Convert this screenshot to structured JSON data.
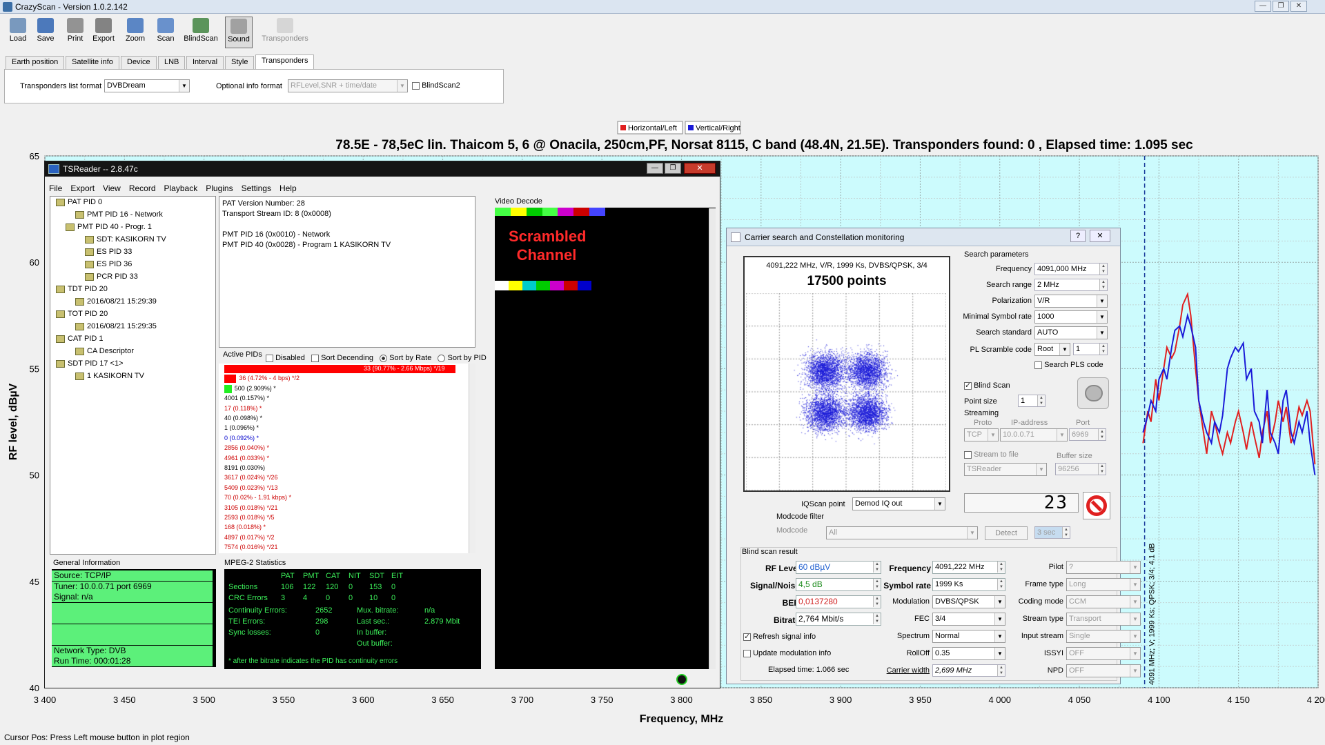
{
  "app": {
    "title": "CrazyScan - Version 1.0.2.142",
    "window_buttons": [
      "—",
      "❐",
      "✕"
    ]
  },
  "toolbar": [
    {
      "label": "Load",
      "icon": "load-icon"
    },
    {
      "label": "Save",
      "icon": "save-icon"
    },
    {
      "label": "Print",
      "icon": "print-icon"
    },
    {
      "label": "Export",
      "icon": "export-icon"
    },
    {
      "label": "Zoom",
      "icon": "zoom-icon"
    },
    {
      "label": "Scan",
      "icon": "scan-icon"
    },
    {
      "label": "BlindScan",
      "icon": "blindscan-icon"
    },
    {
      "label": "Sound",
      "icon": "sound-icon",
      "pressed": true
    },
    {
      "label": "Transponders",
      "icon": "transponders-icon",
      "disabled": true
    }
  ],
  "tabs": [
    "Earth position",
    "Satellite info",
    "Device",
    "LNB",
    "Interval",
    "Style",
    "Transponders"
  ],
  "active_tab": "Transponders",
  "transponders_panel": {
    "list_format_label": "Transponders list format",
    "list_format_value": "DVBDream",
    "optional_label": "Optional info format",
    "optional_value": "RFLevel,SNR + time/date",
    "blindscan2_label": "BlindScan2"
  },
  "chart_data": {
    "type": "line",
    "title": "78.5E - 78,5eC lin. Thaicom 5, 6 @ Onacila, 250cm,PF, Norsat 8115, C band (48.4N, 21.5E). Transponders found: 0 , Elapsed time: 1.095 sec",
    "xlabel": "Frequency, MHz",
    "ylabel": "RF level, dBµV",
    "xlim": [
      3400,
      4200
    ],
    "ylim": [
      40,
      65
    ],
    "x_ticks": [
      "3 400",
      "3 450",
      "3 500",
      "3 550",
      "3 600",
      "3 650",
      "3 700",
      "3 750",
      "3 800",
      "3 850",
      "3 900",
      "3 950",
      "4 000",
      "4 050",
      "4 100",
      "4 150",
      "4 200"
    ],
    "y_ticks": [
      "40",
      "45",
      "50",
      "55",
      "60",
      "65"
    ],
    "legend": {
      "position": "top-center",
      "entries": [
        {
          "name": "Horizontal/Left",
          "color": "#e02020"
        },
        {
          "name": "Vertical/Right",
          "color": "#1a1ad8"
        }
      ]
    },
    "background": "#ccfbfd",
    "marker": {
      "x": 4091,
      "label": "4091 MHz; V; 1999 Ks; QPSK; 3/4; 4.1 dB"
    },
    "series": [
      {
        "name": "Horizontal/Left",
        "color": "#e02020",
        "x": [
          4090,
          4093,
          4095,
          4098,
          4100,
          4103,
          4105,
          4108,
          4110,
          4113,
          4115,
          4118,
          4120,
          4123,
          4125,
          4128,
          4130,
          4133,
          4135,
          4138,
          4140,
          4143,
          4145,
          4148,
          4150,
          4153,
          4155,
          4158,
          4160,
          4163,
          4165,
          4168,
          4170,
          4173,
          4175,
          4178,
          4180,
          4183,
          4185,
          4188,
          4190,
          4193,
          4195,
          4198
        ],
        "values": [
          51.5,
          53.0,
          52.5,
          54.5,
          53.5,
          55.0,
          56.0,
          55.5,
          55.8,
          57.0,
          58.0,
          58.5,
          57.5,
          55.0,
          53.5,
          52.0,
          51.0,
          53.0,
          52.5,
          51.5,
          51.0,
          52.0,
          51.5,
          52.5,
          53.0,
          52.0,
          51.2,
          52.5,
          51.8,
          50.8,
          52.0,
          53.0,
          51.5,
          52.5,
          53.5,
          52.5,
          53.2,
          51.5,
          52.0,
          53.2,
          52.8,
          53.5,
          53.0,
          50.5
        ]
      },
      {
        "name": "Vertical/Right",
        "color": "#1a1ad8",
        "x": [
          4090,
          4093,
          4095,
          4098,
          4100,
          4103,
          4105,
          4108,
          4110,
          4113,
          4115,
          4118,
          4120,
          4123,
          4125,
          4128,
          4130,
          4133,
          4135,
          4138,
          4140,
          4143,
          4145,
          4148,
          4150,
          4153,
          4155,
          4158,
          4160,
          4163,
          4165,
          4168,
          4170,
          4173,
          4175,
          4178,
          4180,
          4183,
          4185,
          4188,
          4190,
          4193,
          4195,
          4198
        ],
        "values": [
          52.0,
          52.8,
          53.5,
          53.0,
          54.5,
          55.0,
          54.5,
          56.0,
          56.8,
          57.0,
          56.5,
          57.5,
          57.0,
          56.0,
          53.5,
          52.5,
          52.0,
          51.5,
          52.5,
          52.0,
          52.8,
          55.0,
          55.5,
          56.0,
          55.8,
          56.2,
          54.5,
          55.0,
          53.0,
          52.5,
          51.5,
          54.0,
          52.0,
          51.5,
          51.0,
          53.5,
          54.0,
          52.0,
          51.5,
          52.5,
          52.0,
          53.0,
          51.5,
          50.0
        ]
      }
    ]
  },
  "tsreader": {
    "title": "TSReader -- 2.8.47c",
    "menu": [
      "File",
      "Export",
      "View",
      "Record",
      "Playback",
      "Plugins",
      "Settings",
      "Help"
    ],
    "tree": [
      {
        "label": "PAT PID 0",
        "indent": 0
      },
      {
        "label": "PMT PID 16 - Network",
        "indent": 2
      },
      {
        "label": "PMT PID 40 - Progr. 1",
        "indent": 1
      },
      {
        "label": "SDT: KASIKORN TV",
        "indent": 3
      },
      {
        "label": "ES PID 33",
        "indent": 3
      },
      {
        "label": "ES PID 36",
        "indent": 3
      },
      {
        "label": "PCR PID 33",
        "indent": 3
      },
      {
        "label": "TDT PID 20",
        "indent": 0
      },
      {
        "label": "2016/08/21 15:29:39",
        "indent": 2
      },
      {
        "label": "TOT PID 20",
        "indent": 0
      },
      {
        "label": "2016/08/21 15:29:35",
        "indent": 2
      },
      {
        "label": "CAT PID 1",
        "indent": 0
      },
      {
        "label": "CA Descriptor",
        "indent": 2
      },
      {
        "label": "SDT PID 17 <1>",
        "indent": 0
      },
      {
        "label": "1 KASIKORN TV",
        "indent": 2
      }
    ],
    "info_text": [
      "PAT Version Number: 28",
      "Transport Stream ID: 8 (0x0008)",
      "",
      "PMT PID 16 (0x0010) - Network",
      "PMT PID 40 (0x0028) - Program 1 KASIKORN TV"
    ],
    "video_decode_label": "Video Decode",
    "scrambled": "Scrambled Channel",
    "active_pids_label": "Active PIDs",
    "pid_options": [
      "Disabled",
      "Sort Decending",
      "Sort by Rate",
      "Sort by PID"
    ],
    "pid_rows": [
      {
        "text": "33 (90.77% - 2.66 Mbps) */19",
        "color": "#ffffff",
        "bar": 1.0,
        "bar_color": "#ff0000"
      },
      {
        "text": "36 (4.72% - 4 bps) */2",
        "color": "#cc0000",
        "bar": 0.052,
        "bar_color": "#ff0000"
      },
      {
        "text": "500 (2.909%) *",
        "color": "#000000",
        "bar": 0.032,
        "bar_color": "#22ee22"
      },
      {
        "text": "4001 (0.157%) *",
        "color": "#000000",
        "bar": 0,
        "bar_color": "#ff0000"
      },
      {
        "text": "17 (0.118%) *",
        "color": "#cc0000",
        "bar": 0,
        "bar_color": "#ff0000"
      },
      {
        "text": "40 (0.098%) *",
        "color": "#000000",
        "bar": 0,
        "bar_color": "#ff0000"
      },
      {
        "text": "1 (0.096%) *",
        "color": "#000000",
        "bar": 0,
        "bar_color": "#ff0000"
      },
      {
        "text": "0 (0.092%) *",
        "color": "#0000cc",
        "bar": 0,
        "bar_color": "#ff0000"
      },
      {
        "text": "2856 (0.040%) *",
        "color": "#cc0000",
        "bar": 0,
        "bar_color": "#ff0000"
      },
      {
        "text": "4961 (0.033%) *",
        "color": "#cc0000",
        "bar": 0,
        "bar_color": "#ff0000"
      },
      {
        "text": "8191 (0.030%)",
        "color": "#000000",
        "bar": 0,
        "bar_color": "#ff0000"
      },
      {
        "text": "3617 (0.024%) */26",
        "color": "#cc0000",
        "bar": 0,
        "bar_color": "#ff0000"
      },
      {
        "text": "5409 (0.023%) */13",
        "color": "#cc0000",
        "bar": 0,
        "bar_color": "#ff0000"
      },
      {
        "text": "70 (0.02% - 1.91 kbps) *",
        "color": "#cc0000",
        "bar": 0,
        "bar_color": "#ff0000"
      },
      {
        "text": "3105 (0.018%) */21",
        "color": "#cc0000",
        "bar": 0,
        "bar_color": "#ff0000"
      },
      {
        "text": "2593 (0.018%) */5",
        "color": "#cc0000",
        "bar": 0,
        "bar_color": "#ff0000"
      },
      {
        "text": "168 (0.018%) *",
        "color": "#cc0000",
        "bar": 0,
        "bar_color": "#ff0000"
      },
      {
        "text": "4897 (0.017%) */2",
        "color": "#cc0000",
        "bar": 0,
        "bar_color": "#ff0000"
      },
      {
        "text": "7574 (0.016%) */21",
        "color": "#cc0000",
        "bar": 0,
        "bar_color": "#ff0000"
      }
    ],
    "general_info_label": "General Information",
    "general_info": [
      "Source: TCP/IP",
      "Tuner: 10.0.0.71 port 6969",
      "Signal: n/a",
      "",
      "",
      "",
      "",
      "Network Type: DVB",
      "Run Time: 000:01:28"
    ],
    "mpeg_label": "MPEG-2 Statistics",
    "mpeg_headers": [
      "PAT",
      "PMT",
      "CAT",
      "NIT",
      "SDT",
      "EIT"
    ],
    "mpeg_rows": [
      {
        "label": "Sections",
        "values": [
          "106",
          "122",
          "120",
          "0",
          "153",
          "0"
        ]
      },
      {
        "label": "CRC Errors",
        "values": [
          "3",
          "4",
          "0",
          "0",
          "10",
          "0"
        ]
      }
    ],
    "mpeg_extra": [
      {
        "label": "Continuity Errors:",
        "value": "2652",
        "label2": "Mux. bitrate:",
        "value2": "n/a"
      },
      {
        "label": "TEI Errors:",
        "value": "298",
        "label2": "Last sec.:",
        "value2": "2.879 Mbit"
      },
      {
        "label": "Sync losses:",
        "value": "0",
        "label2": "In buffer:",
        "value2": ""
      },
      {
        "label": "",
        "value": "",
        "label2": "Out buffer:",
        "value2": ""
      }
    ],
    "mpeg_note": "* after the bitrate indicates the PID has continuity errors"
  },
  "carrier": {
    "title": "Carrier search and Constellation monitoring",
    "title_buttons": [
      "?",
      "✕"
    ],
    "plot_caption": "4091,222 MHz, V/R, 1999 Ks, DVBS/QPSK, 3/4",
    "points_label": "17500 points",
    "search_params_label": "Search parameters",
    "params": [
      {
        "label": "Frequency",
        "value": "4091,000 MHz",
        "kind": "spin"
      },
      {
        "label": "Search range",
        "value": "2 MHz",
        "kind": "spin"
      },
      {
        "label": "Polarization",
        "value": "V/R",
        "kind": "combo"
      },
      {
        "label": "Minimal Symbol rate",
        "value": "1000",
        "kind": "combo"
      },
      {
        "label": "Search standard",
        "value": "AUTO",
        "kind": "combo"
      }
    ],
    "pl_scramble_label": "PL Scramble code",
    "pl_scramble_value": "Root",
    "pl_scramble_num": "1",
    "search_pls_label": "Search PLS code",
    "blind_scan_label": "Blind Scan",
    "point_size_label": "Point size",
    "point_size_value": "1",
    "streaming_label": "Streaming",
    "proto_label": "Proto",
    "proto_value": "TCP",
    "ip_label": "IP-address",
    "ip_value": "10.0.0.71",
    "port_label": "Port",
    "port_value": "6969",
    "stream_file_label": "Stream to file",
    "buffer_label": "Buffer size",
    "buffer_value": "96256",
    "stream_target": "TSReader",
    "iq_label": "IQScan point",
    "iq_value": "Demod IQ out",
    "counter": "23",
    "modcode_filter_label": "Modcode filter",
    "modcode_label": "Modcode",
    "modcode_value": "All",
    "detect_label": "Detect",
    "detect_time": "3 sec",
    "blind_result_label": "Blind scan result",
    "rf_level_label": "RF Level",
    "rf_level_value": "60 dBµV",
    "snr_label": "Signal/Noise",
    "snr_value": "4,5 dB",
    "ber_label": "BER",
    "ber_value": "0,0137280",
    "bitrate_label": "Bitrate",
    "bitrate_value": "2,764 Mbit/s",
    "freq_label": "Frequency",
    "freq_value": "4091,222 MHz",
    "symrate_label": "Symbol rate",
    "symrate_value": "1999 Ks",
    "modulation_label": "Modulation",
    "modulation_value": "DVBS/QPSK",
    "fec_label": "FEC",
    "fec_value": "3/4",
    "spectrum_label": "Spectrum",
    "spectrum_value": "Normal",
    "rolloff_label": "RollOff",
    "rolloff_value": "0.35",
    "carrier_width_label": "Carrier width",
    "carrier_width_value": "2,699 MHz",
    "pilot_label": "Pilot",
    "pilot_value": "?",
    "frame_label": "Frame type",
    "frame_value": "Long",
    "coding_label": "Coding mode",
    "coding_value": "CCM",
    "stream_type_label": "Stream type",
    "stream_type_value": "Transport",
    "input_stream_label": "Input stream",
    "input_stream_value": "Single",
    "issyi_label": "ISSYI",
    "issyi_value": "OFF",
    "npd_label": "NPD",
    "npd_value": "OFF",
    "refresh_label": "Refresh signal info",
    "update_mod_label": "Update modulation info",
    "elapsed": "Elapsed time: 1.066 sec"
  },
  "status_bar": "Cursor Pos: Press Left mouse button in plot region"
}
